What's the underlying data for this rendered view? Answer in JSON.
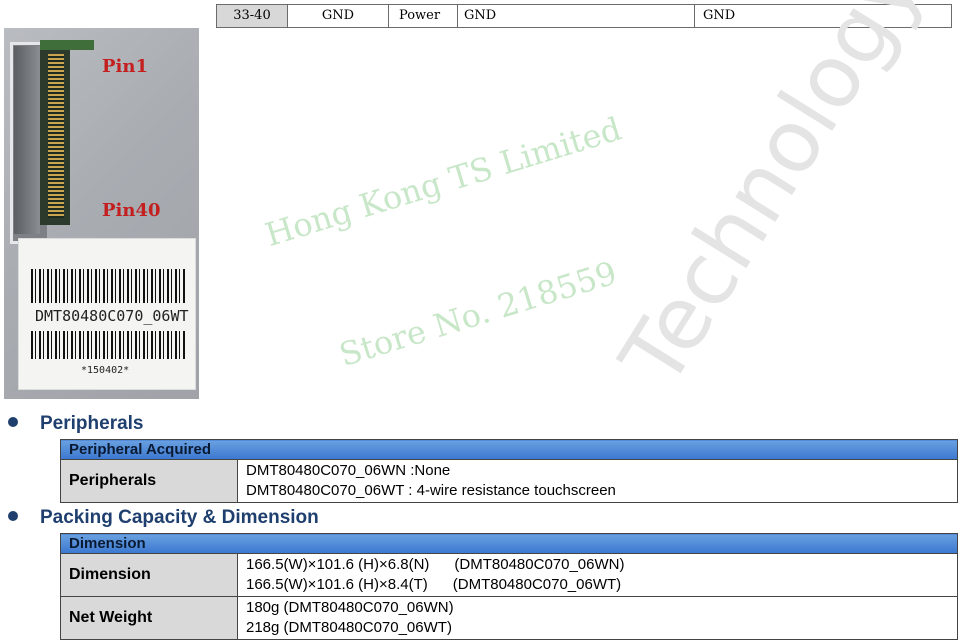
{
  "pin_table": {
    "cells": [
      "33-40",
      "GND",
      "Power",
      "GND",
      "GND"
    ]
  },
  "photo": {
    "pin1_label": "Pin1",
    "pin40_label": "Pin40",
    "sticker_model": "DMT80480C070_06WT",
    "sticker_code": "*150402*"
  },
  "watermark": {
    "line1": "Hong Kong TS Limited",
    "line2": "Store No. 218559",
    "diagonal": "Technology Co., Ltd"
  },
  "peripherals": {
    "section_title": "Peripherals",
    "header": "Peripheral Acquired",
    "rows": [
      {
        "key": "Peripherals",
        "lines": [
          "DMT80480C070_06WN :None",
          "DMT80480C070_06WT : 4-wire resistance touchscreen"
        ]
      }
    ]
  },
  "packing": {
    "section_title": "Packing Capacity & Dimension",
    "header": "Dimension",
    "rows": [
      {
        "key": "Dimension",
        "lines": [
          "166.5(W)×101.6 (H)×6.8(N)      (DMT80480C070_06WN)",
          "166.5(W)×101.6 (H)×8.4(T)      (DMT80480C070_06WT)"
        ]
      },
      {
        "key": "Net Weight",
        "lines": [
          "180g (DMT80480C070_06WN)",
          "218g (DMT80480C070_06WT)"
        ]
      }
    ]
  },
  "colors": {
    "section_title": "#1f3f6e",
    "header_band": "#3b78d0",
    "key_cell": "#d9d9d9",
    "pin_label": "#c31f1f",
    "watermark_green": "#bfe3bf"
  }
}
